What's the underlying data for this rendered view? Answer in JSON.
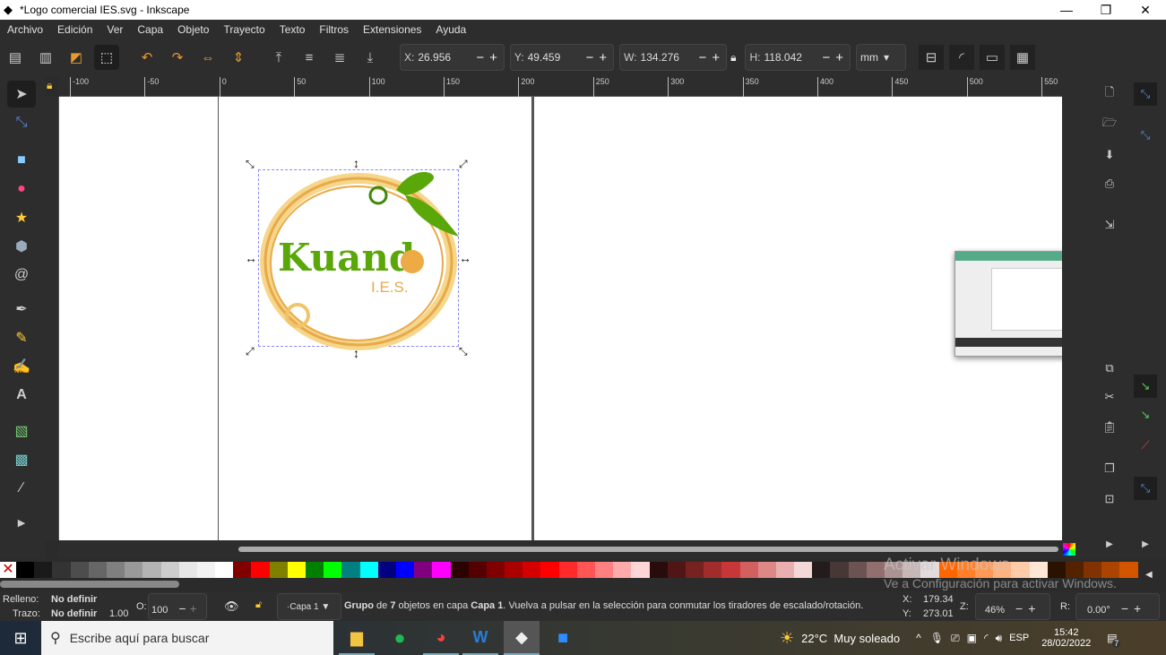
{
  "window": {
    "title": "*Logo comercial IES.svg - Inkscape",
    "minimize": "—",
    "maximize": "❐",
    "close": "✕"
  },
  "menu": [
    "Archivo",
    "Edición",
    "Ver",
    "Capa",
    "Objeto",
    "Trayecto",
    "Texto",
    "Filtros",
    "Extensiones",
    "Ayuda"
  ],
  "toolbar": {
    "x_label": "X:",
    "x": "26.956",
    "y_label": "Y:",
    "y": "49.459",
    "w_label": "W:",
    "w": "134.276",
    "h_label": "H:",
    "h": "118.042",
    "unit": "mm",
    "minus": "−",
    "plus": "+"
  },
  "ruler_ticks": [
    "-100",
    "-50",
    "0",
    "50",
    "100",
    "150",
    "200",
    "250",
    "300",
    "350",
    "400",
    "450",
    "500",
    "550"
  ],
  "logo": {
    "name": "Kuando",
    "sub": "I.E.S."
  },
  "palette": [
    "#000000",
    "#1a1a1a",
    "#333333",
    "#4d4d4d",
    "#666666",
    "#808080",
    "#999999",
    "#b3b3b3",
    "#cccccc",
    "#e6e6e6",
    "#f2f2f2",
    "#ffffff",
    "#800000",
    "#ff0000",
    "#808000",
    "#ffff00",
    "#008000",
    "#00ff00",
    "#008080",
    "#00ffff",
    "#000080",
    "#0000ff",
    "#800080",
    "#ff00ff",
    "#2b0000",
    "#550000",
    "#800000",
    "#aa0000",
    "#d40000",
    "#ff0000",
    "#ff2a2a",
    "#ff5555",
    "#ff8080",
    "#ffaaaa",
    "#ffd5d5",
    "#280b0b",
    "#501616",
    "#782121",
    "#a02c2c",
    "#c83737",
    "#d35f5f",
    "#de8787",
    "#e9afaf",
    "#f4d7d7",
    "#241c1c",
    "#483737",
    "#6c5353",
    "#916f6f",
    "#ac9393",
    "#c8b7b7",
    "#e3dbdb",
    "#ff6600",
    "#ff7f2a",
    "#ff9955",
    "#ffb380",
    "#ffccaa",
    "#ffe6d5",
    "#2b1100",
    "#552200",
    "#803300",
    "#aa4400",
    "#d45500"
  ],
  "watermark": {
    "line1": "Activar Windows",
    "line2": "Ve a Configuración para activar Windows."
  },
  "status": {
    "fill_label": "Relleno:",
    "fill": "No definir",
    "stroke_label": "Trazo:",
    "stroke": "No definir",
    "stroke_width": "1.00",
    "opacity_label": "O:",
    "opacity": "100",
    "layer": "·Capa 1",
    "message_pre": "Grupo",
    "message_mid1": " de ",
    "count": "7",
    "message_mid2": " objetos en capa ",
    "layer_name": "Capa 1",
    "message_post": ". Vuelva a pulsar en la selección para conmutar los tiradores de escalado/rotación.",
    "cx_label": "X:",
    "cx": "179.34",
    "cy_label": "Y:",
    "cy": "273.01",
    "zoom_label": "Z:",
    "zoom": "46%",
    "rot_label": "R:",
    "rotation": "0.00°"
  },
  "taskbar": {
    "search_placeholder": "Escribe aquí para buscar",
    "weather": "22°C  Muy soleado",
    "lang": "ESP",
    "time": "15:42",
    "date": "28/02/2022",
    "notif": "7"
  }
}
